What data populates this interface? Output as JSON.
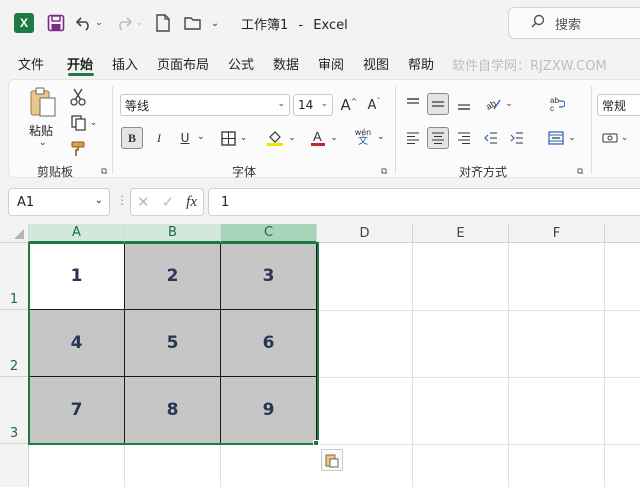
{
  "titlebar": {
    "title": "工作簿1",
    "separator": "-",
    "app": "Excel",
    "search_placeholder": "搜索"
  },
  "tabs": [
    {
      "label": "文件"
    },
    {
      "label": "开始"
    },
    {
      "label": "插入"
    },
    {
      "label": "页面布局"
    },
    {
      "label": "公式"
    },
    {
      "label": "数据"
    },
    {
      "label": "审阅"
    },
    {
      "label": "视图"
    },
    {
      "label": "帮助"
    }
  ],
  "active_tab": "开始",
  "watermark": "软件自学网：RJZXW.COM",
  "ribbon": {
    "clipboard": {
      "paste_label": "粘贴",
      "group_label": "剪贴板"
    },
    "font": {
      "font_name": "等线",
      "font_size": "14",
      "group_label": "字体",
      "bold": "B",
      "italic": "I",
      "underline": "U",
      "phonetic_top": "wén",
      "phonetic_bottom": "文"
    },
    "alignment": {
      "group_label": "对齐方式"
    },
    "number": {
      "format": "常规"
    }
  },
  "formula_bar": {
    "name_box": "A1",
    "fx_label": "fx",
    "value": "1"
  },
  "sheet": {
    "columns": [
      "A",
      "B",
      "C",
      "D",
      "E",
      "F"
    ],
    "rows": [
      "1",
      "2",
      "3"
    ],
    "cells": [
      [
        "1",
        "2",
        "3"
      ],
      [
        "4",
        "5",
        "6"
      ],
      [
        "7",
        "8",
        "9"
      ]
    ]
  },
  "colors": {
    "accent": "#1d7a45",
    "cell_fill": "#c6c6c6",
    "text": "#2b3452"
  }
}
